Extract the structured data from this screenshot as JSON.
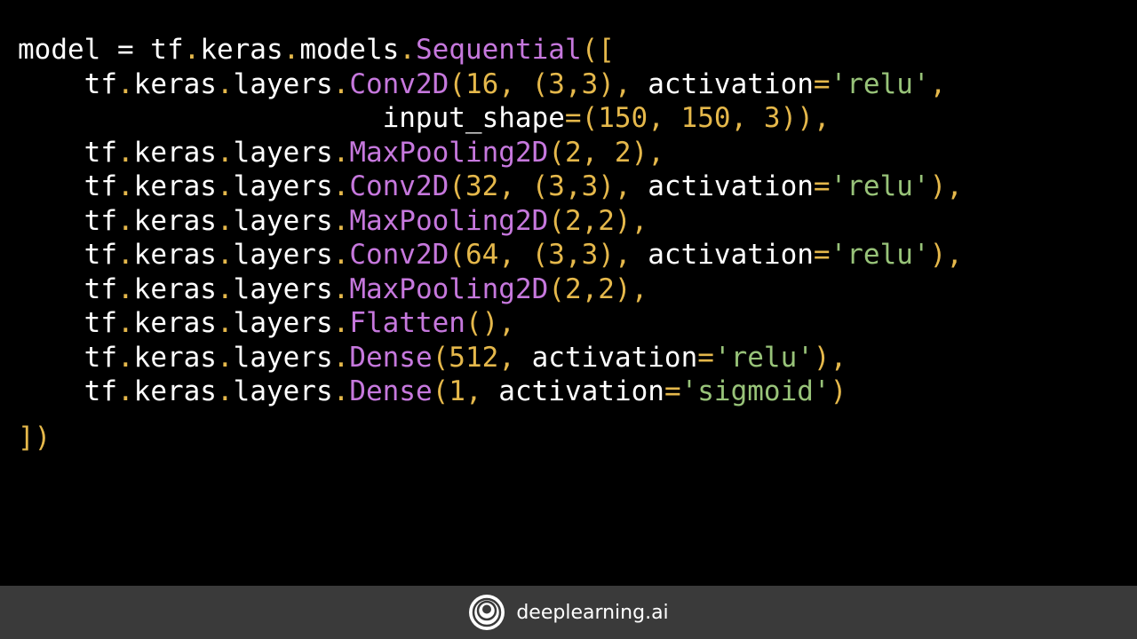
{
  "code": {
    "lines": [
      [
        {
          "t": "model = tf",
          "c": "plain"
        },
        {
          "t": ".",
          "c": "punct"
        },
        {
          "t": "keras",
          "c": "plain"
        },
        {
          "t": ".",
          "c": "punct"
        },
        {
          "t": "models",
          "c": "plain"
        },
        {
          "t": ".",
          "c": "punct"
        },
        {
          "t": "Sequential",
          "c": "call"
        },
        {
          "t": "([",
          "c": "punct"
        }
      ],
      [
        {
          "t": "    tf",
          "c": "plain"
        },
        {
          "t": ".",
          "c": "punct"
        },
        {
          "t": "keras",
          "c": "plain"
        },
        {
          "t": ".",
          "c": "punct"
        },
        {
          "t": "layers",
          "c": "plain"
        },
        {
          "t": ".",
          "c": "punct"
        },
        {
          "t": "Conv2D",
          "c": "call"
        },
        {
          "t": "(16, (3,3), ",
          "c": "punct"
        },
        {
          "t": "activation",
          "c": "plain"
        },
        {
          "t": "=",
          "c": "punct"
        },
        {
          "t": "'relu'",
          "c": "str"
        },
        {
          "t": ",",
          "c": "punct"
        }
      ],
      [
        {
          "t": "                      input_shape",
          "c": "plain"
        },
        {
          "t": "=(150, 150, 3)),",
          "c": "punct"
        }
      ],
      [
        {
          "t": "    tf",
          "c": "plain"
        },
        {
          "t": ".",
          "c": "punct"
        },
        {
          "t": "keras",
          "c": "plain"
        },
        {
          "t": ".",
          "c": "punct"
        },
        {
          "t": "layers",
          "c": "plain"
        },
        {
          "t": ".",
          "c": "punct"
        },
        {
          "t": "MaxPooling2D",
          "c": "call"
        },
        {
          "t": "(2, 2),",
          "c": "punct"
        }
      ],
      [
        {
          "t": "    tf",
          "c": "plain"
        },
        {
          "t": ".",
          "c": "punct"
        },
        {
          "t": "keras",
          "c": "plain"
        },
        {
          "t": ".",
          "c": "punct"
        },
        {
          "t": "layers",
          "c": "plain"
        },
        {
          "t": ".",
          "c": "punct"
        },
        {
          "t": "Conv2D",
          "c": "call"
        },
        {
          "t": "(32, (3,3), ",
          "c": "punct"
        },
        {
          "t": "activation",
          "c": "plain"
        },
        {
          "t": "=",
          "c": "punct"
        },
        {
          "t": "'relu'",
          "c": "str"
        },
        {
          "t": "),",
          "c": "punct"
        }
      ],
      [
        {
          "t": "    tf",
          "c": "plain"
        },
        {
          "t": ".",
          "c": "punct"
        },
        {
          "t": "keras",
          "c": "plain"
        },
        {
          "t": ".",
          "c": "punct"
        },
        {
          "t": "layers",
          "c": "plain"
        },
        {
          "t": ".",
          "c": "punct"
        },
        {
          "t": "MaxPooling2D",
          "c": "call"
        },
        {
          "t": "(2,2),",
          "c": "punct"
        }
      ],
      [
        {
          "t": "    tf",
          "c": "plain"
        },
        {
          "t": ".",
          "c": "punct"
        },
        {
          "t": "keras",
          "c": "plain"
        },
        {
          "t": ".",
          "c": "punct"
        },
        {
          "t": "layers",
          "c": "plain"
        },
        {
          "t": ".",
          "c": "punct"
        },
        {
          "t": "Conv2D",
          "c": "call"
        },
        {
          "t": "(64, (3,3), ",
          "c": "punct"
        },
        {
          "t": "activation",
          "c": "plain"
        },
        {
          "t": "=",
          "c": "punct"
        },
        {
          "t": "'relu'",
          "c": "str"
        },
        {
          "t": "),",
          "c": "punct"
        }
      ],
      [
        {
          "t": "    tf",
          "c": "plain"
        },
        {
          "t": ".",
          "c": "punct"
        },
        {
          "t": "keras",
          "c": "plain"
        },
        {
          "t": ".",
          "c": "punct"
        },
        {
          "t": "layers",
          "c": "plain"
        },
        {
          "t": ".",
          "c": "punct"
        },
        {
          "t": "MaxPooling2D",
          "c": "call"
        },
        {
          "t": "(2,2),",
          "c": "punct"
        }
      ],
      [
        {
          "t": "    tf",
          "c": "plain"
        },
        {
          "t": ".",
          "c": "punct"
        },
        {
          "t": "keras",
          "c": "plain"
        },
        {
          "t": ".",
          "c": "punct"
        },
        {
          "t": "layers",
          "c": "plain"
        },
        {
          "t": ".",
          "c": "punct"
        },
        {
          "t": "Flatten",
          "c": "call"
        },
        {
          "t": "(),",
          "c": "punct"
        }
      ],
      [
        {
          "t": "    tf",
          "c": "plain"
        },
        {
          "t": ".",
          "c": "punct"
        },
        {
          "t": "keras",
          "c": "plain"
        },
        {
          "t": ".",
          "c": "punct"
        },
        {
          "t": "layers",
          "c": "plain"
        },
        {
          "t": ".",
          "c": "punct"
        },
        {
          "t": "Dense",
          "c": "call"
        },
        {
          "t": "(512, ",
          "c": "punct"
        },
        {
          "t": "activation",
          "c": "plain"
        },
        {
          "t": "=",
          "c": "punct"
        },
        {
          "t": "'relu'",
          "c": "str"
        },
        {
          "t": "),",
          "c": "punct"
        }
      ],
      [
        {
          "t": "    tf",
          "c": "plain"
        },
        {
          "t": ".",
          "c": "punct"
        },
        {
          "t": "keras",
          "c": "plain"
        },
        {
          "t": ".",
          "c": "punct"
        },
        {
          "t": "layers",
          "c": "plain"
        },
        {
          "t": ".",
          "c": "punct"
        },
        {
          "t": "Dense",
          "c": "call"
        },
        {
          "t": "(1, ",
          "c": "punct"
        },
        {
          "t": "activation",
          "c": "plain"
        },
        {
          "t": "=",
          "c": "punct"
        },
        {
          "t": "'sigmoid'",
          "c": "str"
        },
        {
          "t": ")",
          "c": "punct"
        }
      ],
      [
        {
          "t": "])",
          "c": "punct"
        }
      ]
    ],
    "colors": {
      "plain": "#ffffff",
      "call": "#c678dd",
      "punct": "#e5b84b",
      "str": "#98c379",
      "background": "#000000"
    }
  },
  "footer": {
    "logo_icon": "deeplearning-ai-logo-icon",
    "brand_name": "deeplearning.ai",
    "background": "#3a3a3a"
  }
}
